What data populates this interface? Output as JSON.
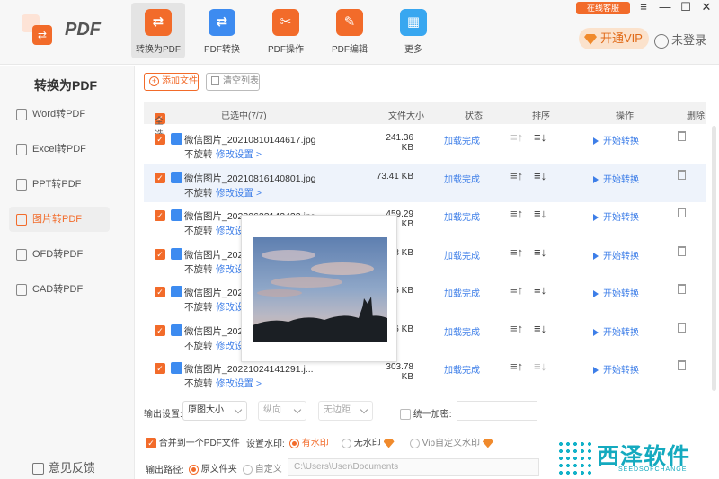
{
  "app": {
    "logo_text": "PDF"
  },
  "nav": [
    {
      "label": "转换为PDF",
      "icon": "pdf-convert-icon",
      "color": "#f26b2a",
      "glyph": "⇄",
      "active": true
    },
    {
      "label": "PDF转换",
      "icon": "pdf-transform-icon",
      "color": "#3d8bf0",
      "glyph": "⇄",
      "active": false
    },
    {
      "label": "PDF操作",
      "icon": "pdf-operation-icon",
      "color": "#f26b2a",
      "glyph": "✂",
      "active": false
    },
    {
      "label": "PDF编辑",
      "icon": "pdf-edit-icon",
      "color": "#f26b2a",
      "glyph": "✎",
      "active": false
    },
    {
      "label": "更多",
      "icon": "more-grid-icon",
      "color": "#38a7f0",
      "glyph": "▦",
      "active": false
    }
  ],
  "header": {
    "online_service": "在线客服",
    "vip_label": "开通VIP",
    "login_label": "未登录",
    "window_controls": {
      "menu": "≡",
      "minimize": "—",
      "maximize": "☐",
      "close": "✕"
    }
  },
  "sidebar": {
    "title": "转换为PDF",
    "items": [
      {
        "label": "Word转PDF"
      },
      {
        "label": "Excel转PDF"
      },
      {
        "label": "PPT转PDF"
      },
      {
        "label": "图片转PDF",
        "active": true
      },
      {
        "label": "OFD转PDF"
      },
      {
        "label": "CAD转PDF"
      }
    ],
    "feedback": "意见反馈"
  },
  "toolbar": {
    "add_file": "添加文件",
    "clear_list": "清空列表"
  },
  "table": {
    "headers": {
      "select_all": "全选",
      "selected": "已选中(7/7)",
      "size": "文件大小",
      "status": "状态",
      "sort": "排序",
      "action": "操作",
      "delete": "删除"
    },
    "rows": [
      {
        "name": "微信图片_20210810144617.jpg",
        "rotate": "不旋转",
        "modify": "修改设置 >",
        "size": "241.36 KB",
        "status": "加载完成",
        "action": "开始转换",
        "up_disabled": true,
        "down_disabled": false
      },
      {
        "name": "微信图片_20210816140801.jpg",
        "rotate": "不旋转",
        "modify": "修改设置 >",
        "size": "73.41 KB",
        "status": "加载完成",
        "action": "开始转换",
        "up_disabled": false,
        "down_disabled": false
      },
      {
        "name": "微信图片_20220623143433.jpg",
        "rotate": "不旋转",
        "modify": "修改设置 >",
        "size": "459.29 KB",
        "status": "加载完成",
        "action": "开始转换",
        "up_disabled": false,
        "down_disabled": false
      },
      {
        "name": "微信图片_20220",
        "rotate": "不旋转",
        "modify": "修改设置 >",
        "size": "3 KB",
        "status": "加载完成",
        "action": "开始转换",
        "up_disabled": false,
        "down_disabled": false
      },
      {
        "name": "微信图片_20220",
        "rotate": "不旋转",
        "modify": "修改设置 >",
        "size": "25 KB",
        "status": "加载完成",
        "action": "开始转换",
        "up_disabled": false,
        "down_disabled": false
      },
      {
        "name": "微信图片_20221",
        "rotate": "不旋转",
        "modify": "修改设置 >",
        "size": "66 KB",
        "status": "加载完成",
        "action": "开始转换",
        "up_disabled": false,
        "down_disabled": false
      },
      {
        "name": "微信图片_20221024141291.j...",
        "rotate": "不旋转",
        "modify": "修改设置 >",
        "size": "303.78 KB",
        "status": "加载完成",
        "action": "开始转换",
        "up_disabled": false,
        "down_disabled": true
      }
    ]
  },
  "settings": {
    "output_label": "输出设置:",
    "size_value": "原图大小",
    "orientation_value": "纵向",
    "margin_value": "无边距",
    "encrypt_label": "统一加密:",
    "merge_label": "合并到一个PDF文件",
    "watermark_label": "设置水印:",
    "watermark_options": [
      "有水印",
      "无水印",
      "Vip自定义水印"
    ],
    "path_label": "输出路径:",
    "path_options": [
      "原文件夹",
      "自定义"
    ],
    "path_value": "C:\\Users\\User\\Documents"
  },
  "watermark_logo": {
    "text": "西泽软件",
    "sub": "SEEDSOFCHANGE"
  }
}
